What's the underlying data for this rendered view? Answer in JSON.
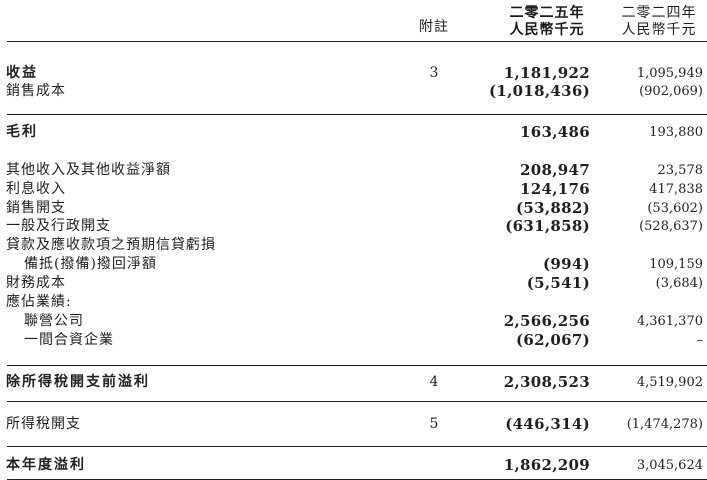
{
  "header": {
    "note_label": "附註",
    "year_2025_line1": "二零二五年",
    "year_2025_line2": "人民幣千元",
    "year_2024_line1": "二零二四年",
    "year_2024_line2": "人民幣千元"
  },
  "rows": [
    {
      "label": "收益",
      "note": "3",
      "v2025": "1,181,922",
      "v2024": "1,095,949"
    },
    {
      "label": "銷售成本",
      "note": "",
      "v2025": "(1,018,436)",
      "v2024": "(902,069)"
    },
    {
      "label": "毛利",
      "note": "",
      "v2025": "163,486",
      "v2024": "193,880"
    },
    {
      "label": "其他收入及其他收益淨額",
      "note": "",
      "v2025": "208,947",
      "v2024": "23,578"
    },
    {
      "label": "利息收入",
      "note": "",
      "v2025": "124,176",
      "v2024": "417,838"
    },
    {
      "label": "銷售開支",
      "note": "",
      "v2025": "(53,882)",
      "v2024": "(53,602)"
    },
    {
      "label": "一般及行政開支",
      "note": "",
      "v2025": "(631,858)",
      "v2024": "(528,637)"
    },
    {
      "label": "貸款及應收款項之預期信貸虧損",
      "note": "",
      "v2025": "",
      "v2024": ""
    },
    {
      "label": "備抵(撥備)撥回淨額",
      "note": "",
      "v2025": "(994)",
      "v2024": "109,159"
    },
    {
      "label": "財務成本",
      "note": "",
      "v2025": "(5,541)",
      "v2024": "(3,684)"
    },
    {
      "label": "應佔業績:",
      "note": "",
      "v2025": "",
      "v2024": ""
    },
    {
      "label": "聯營公司",
      "note": "",
      "v2025": "2,566,256",
      "v2024": "4,361,370"
    },
    {
      "label": "一間合資企業",
      "note": "",
      "v2025": "(62,067)",
      "v2024": "–"
    },
    {
      "label": "除所得稅開支前溢利",
      "note": "4",
      "v2025": "2,308,523",
      "v2024": "4,519,902"
    },
    {
      "label": "所得稅開支",
      "note": "5",
      "v2025": "(446,314)",
      "v2024": "(1,474,278)"
    },
    {
      "label": "本年度溢利",
      "note": "",
      "v2025": "1,862,209",
      "v2024": "3,045,624"
    }
  ]
}
